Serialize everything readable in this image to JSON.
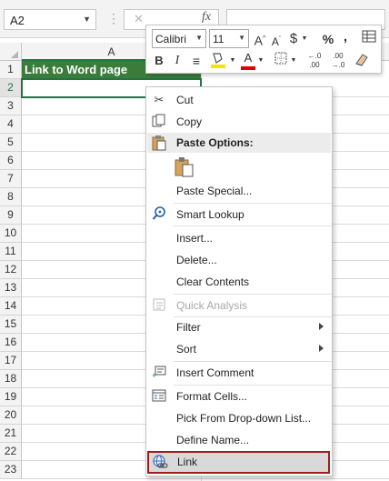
{
  "name_box": {
    "value": "A2"
  },
  "formula_bar": {
    "fx_label": "fx",
    "value": ""
  },
  "sheet": {
    "columns": [
      "A"
    ],
    "rows": [
      "1",
      "2",
      "3",
      "4",
      "5",
      "6",
      "7",
      "8",
      "9",
      "10",
      "11",
      "12",
      "13",
      "14",
      "15",
      "16",
      "17",
      "18",
      "19",
      "20",
      "21",
      "22",
      "23"
    ],
    "active_cell": "A2",
    "cells": {
      "A1": "Link to Word page"
    },
    "header_fill_color": "#3a7d3a",
    "selection_color": "#217346"
  },
  "mini_toolbar": {
    "font_name": "Calibri",
    "font_size": "11",
    "buttons": [
      "increase-font-size",
      "decrease-font-size",
      "currency",
      "percent",
      "comma-style",
      "format-painter-table",
      "bold",
      "italic",
      "align-center",
      "fill-color",
      "font-color",
      "borders",
      "increase-decimal",
      "decrease-decimal",
      "clear-format"
    ]
  },
  "context_menu": {
    "items": [
      {
        "label": "Cut",
        "icon": "scissors-icon",
        "enabled": true
      },
      {
        "label": "Copy",
        "icon": "copy-icon",
        "enabled": true
      },
      {
        "label": "Paste Options:",
        "icon": "clipboard-icon",
        "enabled": true
      },
      {
        "label": "Paste Special...",
        "icon": "",
        "enabled": true
      },
      {
        "label": "Smart Lookup",
        "icon": "search-icon",
        "enabled": true
      },
      {
        "label": "Insert...",
        "icon": "",
        "enabled": true
      },
      {
        "label": "Delete...",
        "icon": "",
        "enabled": true
      },
      {
        "label": "Clear Contents",
        "icon": "",
        "enabled": true
      },
      {
        "label": "Quick Analysis",
        "icon": "quick-analysis-icon",
        "enabled": false
      },
      {
        "label": "Filter",
        "icon": "",
        "enabled": true,
        "submenu": true
      },
      {
        "label": "Sort",
        "icon": "",
        "enabled": true,
        "submenu": true
      },
      {
        "label": "Insert Comment",
        "icon": "comment-icon",
        "enabled": true
      },
      {
        "label": "Format Cells...",
        "icon": "format-cells-icon",
        "enabled": true
      },
      {
        "label": "Pick From Drop-down List...",
        "icon": "",
        "enabled": true
      },
      {
        "label": "Define Name...",
        "icon": "",
        "enabled": true
      },
      {
        "label": "Link",
        "icon": "link-icon",
        "enabled": true,
        "highlighted": true
      }
    ],
    "highlight_border_color": "#a11d1d"
  }
}
